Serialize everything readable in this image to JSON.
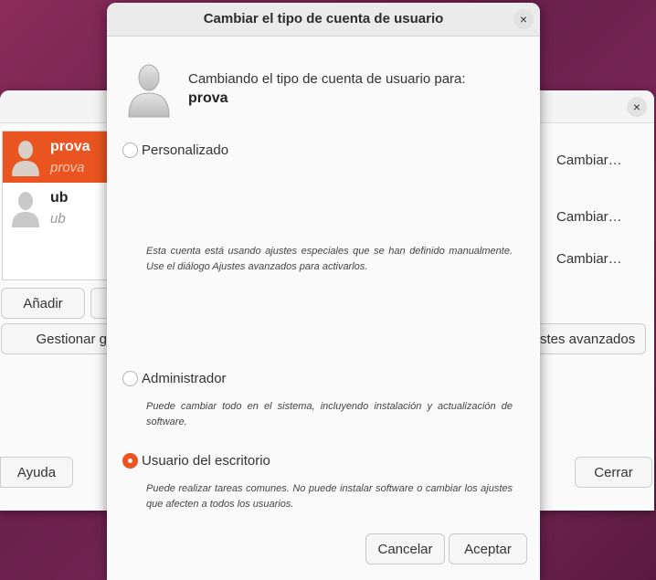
{
  "background_window": {
    "users": [
      {
        "username": "prova",
        "realname": "prova",
        "selected": true
      },
      {
        "username": "ub",
        "realname": "ub",
        "selected": false
      }
    ],
    "add_label": "Añadir",
    "manage_label": "Gestionar g",
    "advanced_label": "stes avanzados",
    "change_labels": [
      "Cambiar…",
      "Cambiar…",
      "Cambiar…"
    ],
    "help_label": "Ayuda",
    "close_label": "Cerrar",
    "close_icon": "×"
  },
  "dialog": {
    "title": "Cambiar el tipo de cuenta de usuario",
    "close_icon": "×",
    "heading": "Cambiando el tipo de cuenta de usuario para:",
    "username": "prova",
    "options": [
      {
        "label": "Personalizado",
        "checked": false,
        "description": "Esta cuenta está usando ajustes especiales que se han definido manualmente. Use el diálogo Ajustes avanzados para activarlos."
      },
      {
        "label": "Administrador",
        "checked": false,
        "description": "Puede cambiar todo en el sistema, incluyendo instalación y actualización de software."
      },
      {
        "label": "Usuario del escritorio",
        "checked": true,
        "description": "Puede realizar tareas comunes. No puede instalar software o cambiar los ajustes que afecten a todos los usuarios."
      }
    ],
    "cancel_label": "Cancelar",
    "accept_label": "Aceptar"
  },
  "colors": {
    "accent": "#e95420"
  }
}
